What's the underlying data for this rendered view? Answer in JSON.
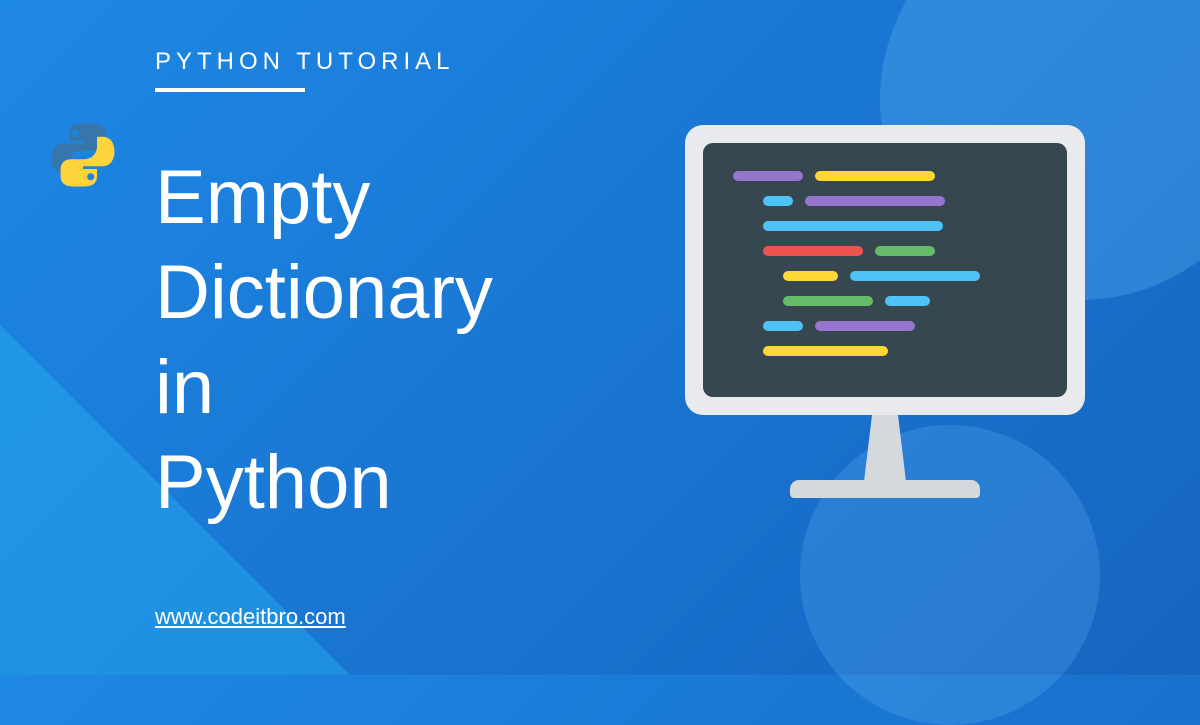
{
  "category": "PYTHON TUTORIAL",
  "title": "Empty\nDictionary\nin\nPython",
  "website": "www.codeitbro.com",
  "codeColors": {
    "purple": "#9575cd",
    "yellow": "#fdd835",
    "blue": "#4fc3f7",
    "red": "#ef5350",
    "green": "#66bb6a"
  }
}
